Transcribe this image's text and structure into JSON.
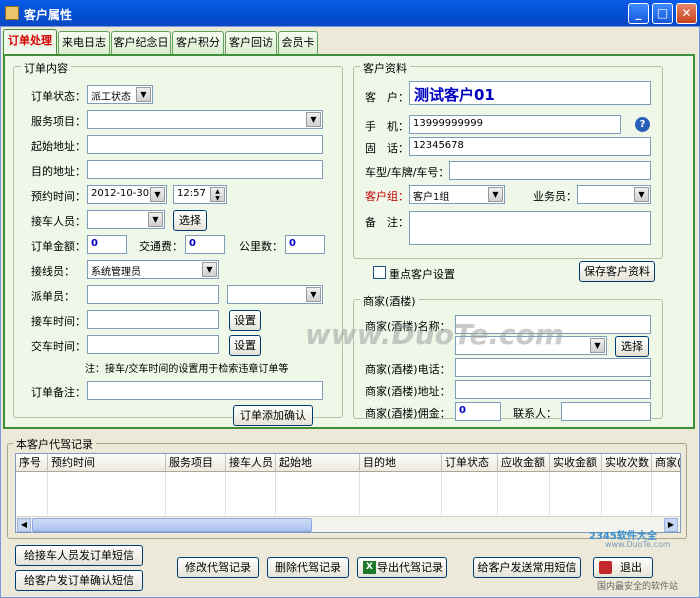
{
  "window": {
    "title": "客户属性",
    "btn_min": "_",
    "btn_max": "□",
    "btn_close": "✕"
  },
  "tabs": [
    "订单处理",
    "来电日志",
    "客户纪念日",
    "客户积分",
    "客户回访",
    "会员卡"
  ],
  "order": {
    "group_title": "订单内容",
    "status_label": "订单状态：",
    "status_value": "派工状态",
    "service_label": "服务项目：",
    "service_value": "",
    "start_label": "起始地址：",
    "start_value": "",
    "dest_label": "目的地址：",
    "dest_value": "",
    "time_label": "预约时间：",
    "date_value": "2012-10-30",
    "time_value": "12:57",
    "driver_label": "接车人员：",
    "driver_value": "",
    "select_btn": "选择",
    "amount_label": "订单金额：",
    "amount_value": "0",
    "traffic_label": "交通费：",
    "traffic_value": "0",
    "km_label": "公里数：",
    "km_value": "0",
    "operator_label": "接线员：",
    "operator_value": "系统管理员",
    "dispatcher_label": "派单员：",
    "dispatcher_value": "",
    "pickup_label": "接车时间：",
    "pickup_value": "",
    "set_btn": "设置",
    "return_label": "交车时间：",
    "return_value": "",
    "set_btn2": "设置",
    "note": "注：接车/交车时间的设置用于检索违章订单等",
    "remark_label": "订单备注：",
    "remark_value": "",
    "confirm_btn": "订单添加确认"
  },
  "customer": {
    "group_title": "客户资料",
    "name_label": "客　户：",
    "name_value": "测试客户01",
    "mobile_label": "手　机：",
    "mobile_value": "13999999999",
    "phone_label": "固　话：",
    "phone_value": "12345678",
    "car_label": "车型/车牌/车号：",
    "car_value": "",
    "group_label": "客户组：",
    "group_value": "客户1组",
    "sales_label": "业务员：",
    "sales_value": "",
    "note_label": "备　注：",
    "note_value": "",
    "key_label": "重点客户设置",
    "save_btn": "保存客户资料"
  },
  "merchant": {
    "group_title": "商家(酒楼)",
    "name_label": "商家(酒楼)名称：",
    "name_value": "",
    "select_value": "",
    "select_btn": "选择",
    "phone_label": "商家(酒楼)电话：",
    "phone_value": "",
    "addr_label": "商家(酒楼)地址：",
    "addr_value": "",
    "commission_label": "商家(酒楼)佣金：",
    "commission_value": "0",
    "contact_label": "联系人：",
    "contact_value": ""
  },
  "records": {
    "group_title": "本客户代驾记录",
    "columns": [
      "序号",
      "预约时间",
      "服务项目",
      "接车人员",
      "起始地",
      "目的地",
      "订单状态",
      "应收金额",
      "实收金额",
      "实收次数",
      "商家("
    ]
  },
  "buttons": {
    "sms_driver": "给接车人员发订单短信",
    "sms_customer": "给客户发订单确认短信",
    "edit": "修改代驾记录",
    "delete": "删除代驾记录",
    "export": "导出代驾记录",
    "sms_common": "给客户发送常用短信",
    "exit": "退出"
  },
  "watermark": {
    "center": "www.DuoTe.com",
    "corner_brand": "2345软件大全",
    "corner_url": "www.DuoTe.com",
    "corner_sub": "国内最安全的软件站"
  }
}
